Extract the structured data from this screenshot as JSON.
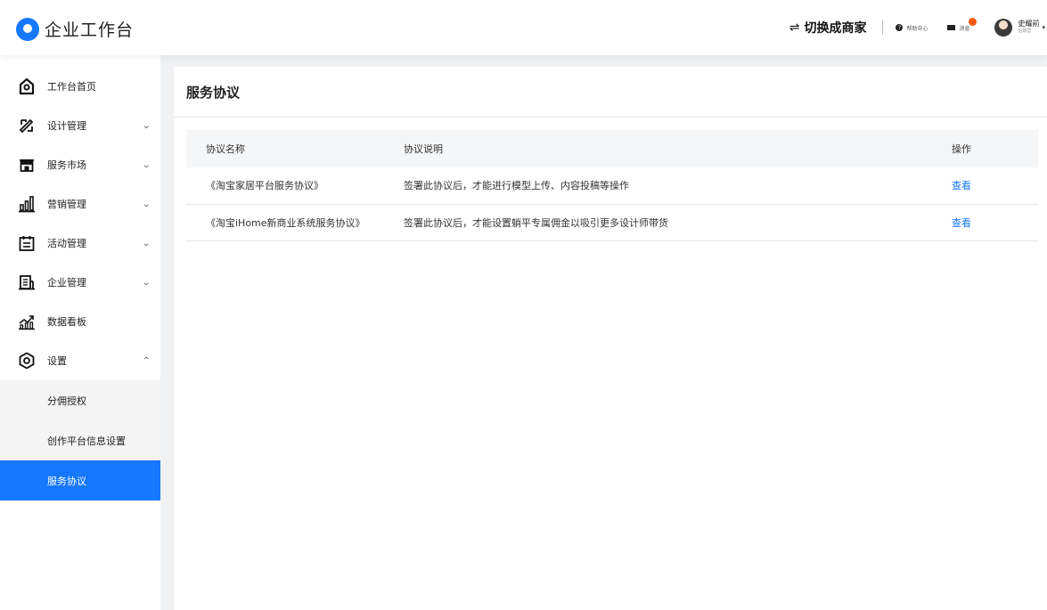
{
  "header": {
    "app_title": "企业工作台",
    "switch_label": "切换成商家",
    "help_label": "帮助中心",
    "messages_label": "消息",
    "user_name": "史耀前",
    "user_role": "后端营"
  },
  "sidebar": {
    "items": [
      {
        "label": "工作台首页",
        "icon": "home-icon"
      },
      {
        "label": "设计管理",
        "icon": "design-tools-icon"
      },
      {
        "label": "服务市场",
        "icon": "store-icon"
      },
      {
        "label": "营销管理",
        "icon": "bar-chart-icon"
      },
      {
        "label": "活动管理",
        "icon": "calendar-icon"
      },
      {
        "label": "企业管理",
        "icon": "building-icon"
      },
      {
        "label": "数据看板",
        "icon": "trend-chart-icon"
      },
      {
        "label": "设置",
        "icon": "settings-icon"
      }
    ],
    "sub_items": [
      "分佣授权",
      "创作平台信息设置",
      "服务协议"
    ]
  },
  "main": {
    "page_title": "服务协议",
    "table": {
      "headers": [
        "协议名称",
        "协议说明",
        "操作"
      ],
      "rows": [
        {
          "name": "《淘宝家居平台服务协议》",
          "desc": "签署此协议后，才能进行模型上传、内容投稿等操作",
          "action": "查看"
        },
        {
          "name": "《淘宝iHome新商业系统服务协议》",
          "desc": "签署此协议后，才能设置躺平专属佣金以吸引更多设计师带货",
          "action": "查看"
        }
      ]
    }
  },
  "colors": {
    "accent": "#1677ff",
    "badge": "#f5580e"
  }
}
